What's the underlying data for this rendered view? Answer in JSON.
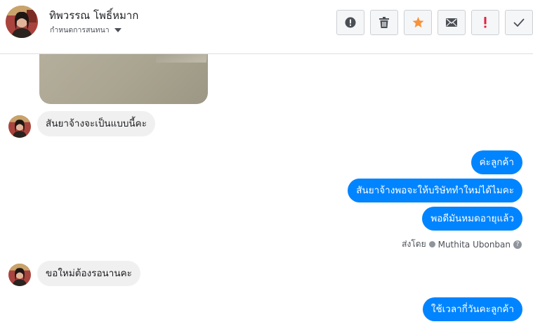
{
  "header": {
    "contact_name": "ทิพวรรณ โพธิ์หมาก",
    "conversation_settings": "กำหนดการสนทนา",
    "actions": [
      {
        "name": "report-icon",
        "label": "report"
      },
      {
        "name": "delete-icon",
        "label": "delete"
      },
      {
        "name": "star-icon",
        "label": "star"
      },
      {
        "name": "mark-unread-icon",
        "label": "mark unread"
      },
      {
        "name": "spam-icon",
        "label": "spam"
      },
      {
        "name": "done-icon",
        "label": "done"
      }
    ]
  },
  "messages": [
    {
      "from": "contact",
      "text": "สันยาจ้างจะเป็นแบบนี้คะ"
    },
    {
      "from": "page",
      "text": "ค่ะลูกค้า"
    },
    {
      "from": "page",
      "text": "สันยาจ้างพอจะให้บริษัททำใหม่ได้ไมคะ"
    },
    {
      "from": "page",
      "text": "พอดีมันหมดอายุแล้ว"
    },
    {
      "from": "contact",
      "text": "ขอใหม่ต้องรอนานคะ"
    },
    {
      "from": "page",
      "text": "ใช้เวลากี่วันคะลูกค้า"
    }
  ],
  "sent_by": {
    "prefix": "ส่งโดย",
    "name": "Muthita Ubonban",
    "help": "?"
  },
  "colors": {
    "outgoing_bubble": "#0084ff",
    "incoming_bubble": "#f1f0f0",
    "star": "#f7923a",
    "spam": "#e41e3f"
  }
}
